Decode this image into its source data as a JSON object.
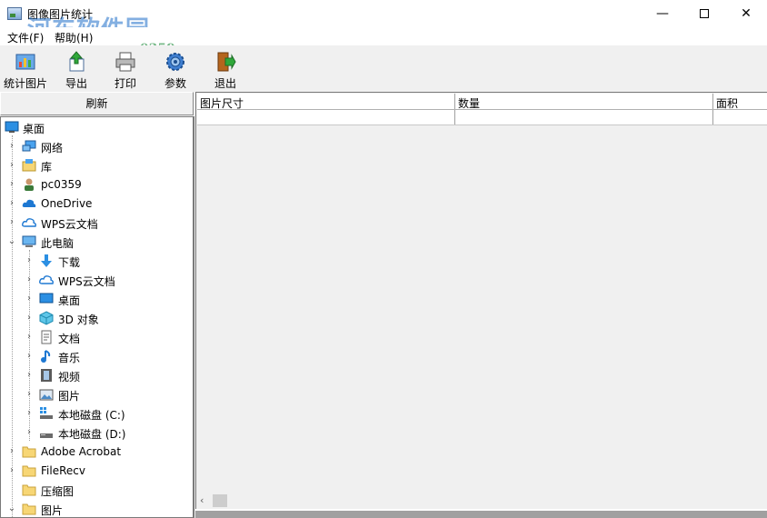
{
  "window": {
    "title": "图像图片统计",
    "minimize": "—",
    "close": "✕",
    "watermark": "河东软件园",
    "watermark_url": "www.pc0359.cn"
  },
  "menu": {
    "file": "文件(F)",
    "help": "帮助(H)"
  },
  "toolbar": {
    "count_images": "统计图片",
    "export": "导出",
    "print": "打印",
    "params": "参数",
    "exit": "退出"
  },
  "sidebar": {
    "refresh": "刷新",
    "tree": {
      "desktop": "桌面",
      "network": "网络",
      "library": "库",
      "user": "pc0359",
      "onedrive": "OneDrive",
      "wps_cloud": "WPS云文档",
      "this_pc": "此电脑",
      "downloads": "下载",
      "pc_wps_cloud": "WPS云文档",
      "pc_desktop": "桌面",
      "objects3d": "3D 对象",
      "documents": "文档",
      "music": "音乐",
      "videos": "视频",
      "pictures": "图片",
      "drive_c": "本地磁盘 (C:)",
      "drive_d": "本地磁盘 (D:)",
      "adobe": "Adobe Acrobat",
      "filerecv": "FileRecv",
      "compressed": "压缩图",
      "pictures2": "图片"
    }
  },
  "grid": {
    "columns": [
      "图片尺寸",
      "数量",
      "面积"
    ]
  },
  "colors": {
    "folder": "#f7d675",
    "accent_blue": "#1e78d2",
    "title_bg": "#ffffff",
    "window_bg": "#f0f0f0"
  }
}
